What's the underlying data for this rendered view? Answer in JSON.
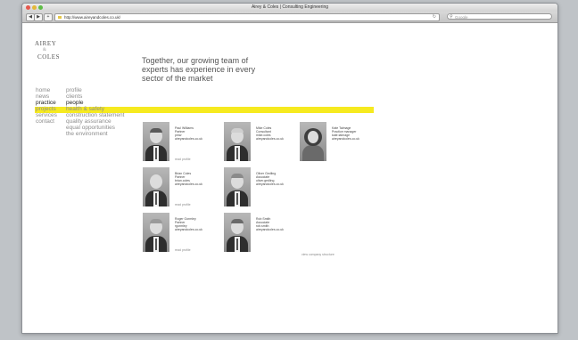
{
  "browser": {
    "title": "Airey & Coles | Consulting Engineering",
    "url": "http://www.aireyandcoles.co.uk/",
    "search_placeholder": "Google"
  },
  "logo": {
    "line1": "AIREY",
    "ampersand": "&",
    "line2": "COLES"
  },
  "tagline": {
    "line1": "Together, our growing team of",
    "line2": "experts has experience in every",
    "line3": "sector of the market"
  },
  "nav": {
    "primary": [
      "home",
      "news",
      "practice",
      "projects",
      "services",
      "contact"
    ],
    "secondary": [
      "profile",
      "clients",
      "people",
      "health & safety",
      "construction statement",
      "quality assurance",
      "equal opportunities",
      "the environment"
    ],
    "active_primary": "practice",
    "active_secondary": "people"
  },
  "people": [
    {
      "name": "Paul Williams",
      "role": "Partner",
      "email_user": "pmw",
      "email_domain": "aireyandcoles.co.uk",
      "link": "read profile"
    },
    {
      "name": "Mike Coles",
      "role": "Consultant",
      "email_user": "mike.coles",
      "email_domain": "aireyandcoles.co.uk",
      "link": ""
    },
    {
      "name": "Kate Talmage",
      "role": "Practice manager",
      "email_user": "kate.talmage",
      "email_domain": "aireyandcoles.co.uk",
      "link": ""
    },
    {
      "name": "Brian Coles",
      "role": "Partner",
      "email_user": "brian.coles",
      "email_domain": "aireyandcoles.co.uk",
      "link": "read profile"
    },
    {
      "name": "Oliver Gedling",
      "role": "Associate",
      "email_user": "oliver.gedling",
      "email_domain": "aireyandcoles.co.uk",
      "link": ""
    },
    {
      "name": "Roger Gormley",
      "role": "Partner",
      "email_user": "rgormley",
      "email_domain": "aireyandcoles.co.uk",
      "link": "read profile"
    },
    {
      "name": "Rob Smith",
      "role": "Associate",
      "email_user": "rob.smith",
      "email_domain": "aireyandcoles.co.uk",
      "link": ""
    }
  ],
  "view_structure": "view company structure",
  "colors": {
    "highlight": "#f6ea20",
    "nav_text": "#8c8c8c",
    "active_text": "#222222"
  }
}
